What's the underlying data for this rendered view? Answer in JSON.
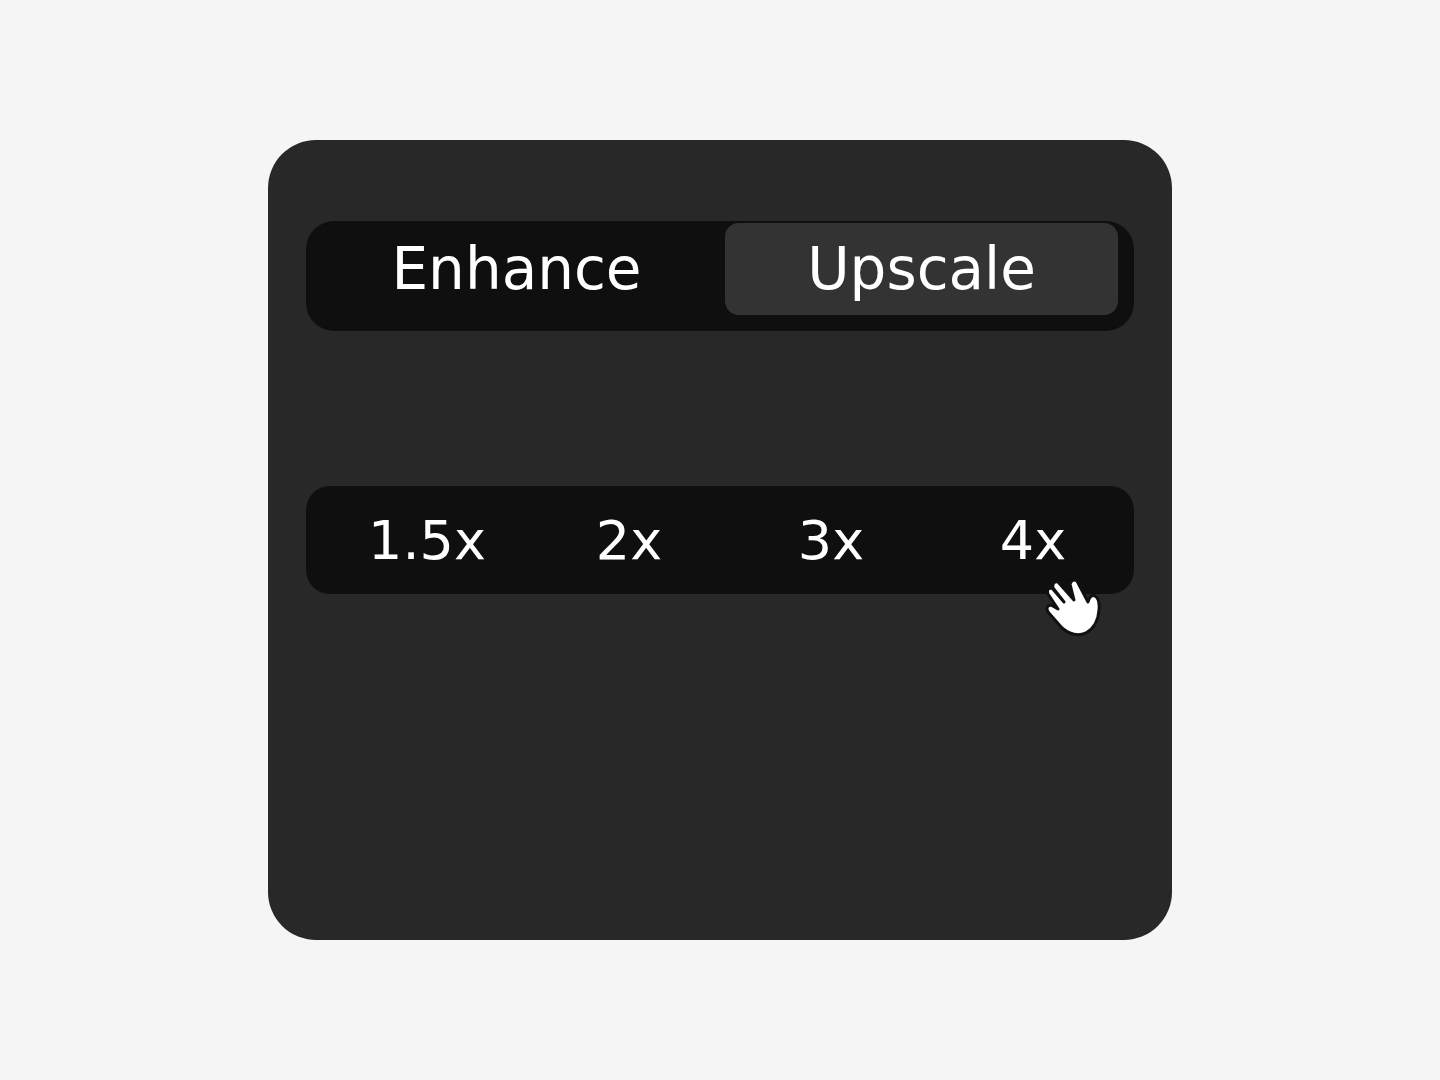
{
  "mode_tabs": [
    {
      "label": "Enhance",
      "selected": false
    },
    {
      "label": "Upscale",
      "selected": true
    }
  ],
  "scale_options": [
    {
      "label": "1.5x"
    },
    {
      "label": "2x"
    },
    {
      "label": "3x"
    },
    {
      "label": "4x"
    }
  ]
}
